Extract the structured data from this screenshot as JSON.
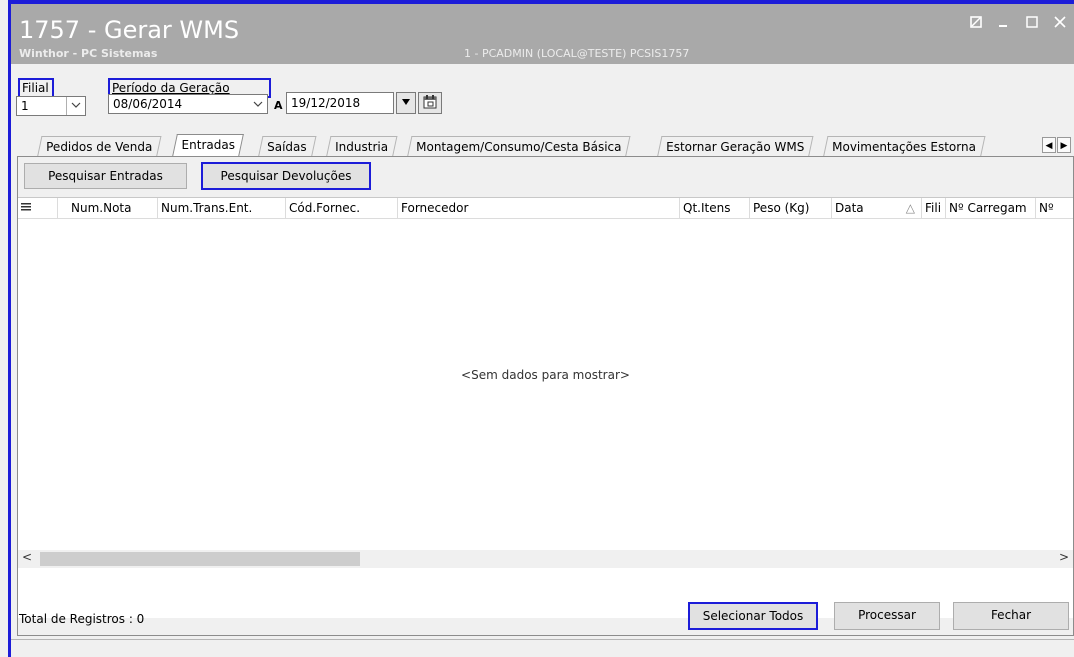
{
  "window": {
    "title": "1757 - Gerar WMS",
    "subtitle": "Winthor - PC Sistemas",
    "session": "1 - PCADMIN (LOCAL@TESTE)  PCSIS1757",
    "controls": [
      "restore-icon",
      "minimize-icon",
      "maximize-icon",
      "close-icon"
    ]
  },
  "filters": {
    "filial_label": "Filial",
    "filial_value": "1",
    "periodo_label": "Período da Geração",
    "date_from": "08/06/2014",
    "a_label": "A",
    "date_to": "19/12/2018"
  },
  "tabs": [
    {
      "label": "Pedidos de Venda",
      "active": false
    },
    {
      "label": "Entradas",
      "active": true
    },
    {
      "label": "Saídas",
      "active": false
    },
    {
      "label": "Industria",
      "active": false
    },
    {
      "label": "Montagem/Consumo/Cesta Básica",
      "active": false
    },
    {
      "label": "Estornar Geração WMS",
      "active": false
    },
    {
      "label": "Movimentações Estorna",
      "active": false
    }
  ],
  "toolbar": {
    "pesquisar_entradas": "Pesquisar Entradas",
    "pesquisar_devolucoes": "Pesquisar Devoluções"
  },
  "grid": {
    "columns": [
      "Num.Nota",
      "Num.Trans.Ent.",
      "Cód.Fornec.",
      "Fornecedor",
      "Qt.Itens",
      "Peso (Kg)",
      "Data",
      "Fili",
      "Nº Carregam",
      "Nº"
    ],
    "empty_message": "<Sem dados para mostrar>"
  },
  "footer": {
    "total_label": "Total de Registros : 0",
    "selecionar_todos": "Selecionar Todos",
    "processar": "Processar",
    "fechar": "Fechar"
  },
  "colors": {
    "highlight": "#1c1cd8",
    "titlebar": "#a9a9a9"
  }
}
